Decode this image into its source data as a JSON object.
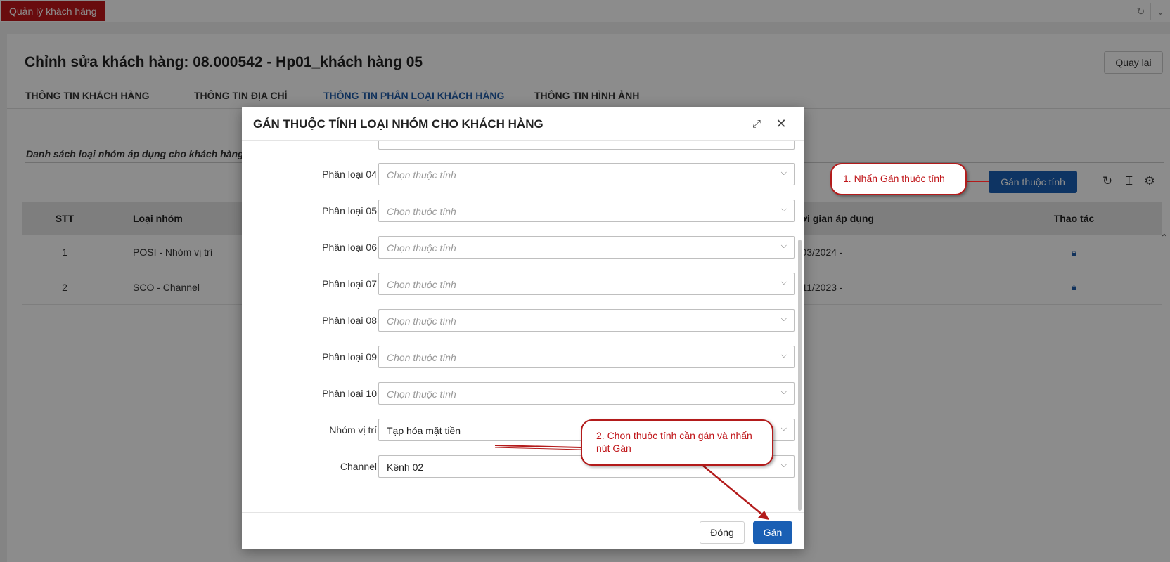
{
  "app_tab": "Quản lý khách hàng",
  "page": {
    "title": "Chỉnh sửa khách hàng: 08.000542 - Hp01_khách hàng 05",
    "back_label": "Quay lại",
    "tabs": [
      {
        "label": "THÔNG TIN KHÁCH HÀNG"
      },
      {
        "label": "THÔNG TIN ĐỊA CHỈ"
      },
      {
        "label": "THÔNG TIN PHÂN LOẠI KHÁCH HÀNG"
      },
      {
        "label": "THÔNG TIN HÌNH ẢNH"
      }
    ],
    "list_title": "Danh sách loại nhóm áp dụng cho khách hàng",
    "assign_label": "Gán thuộc tính",
    "table": {
      "headers": {
        "stt": "STT",
        "group": "Loại nhóm",
        "time": "Thời gian áp dụng",
        "action": "Thao tác"
      },
      "rows": [
        {
          "stt": "1",
          "group": "POSI - Nhóm vị trí",
          "time": "11/03/2024 -"
        },
        {
          "stt": "2",
          "group": "SCO - Channel",
          "time": "22/11/2023 -"
        }
      ]
    }
  },
  "modal": {
    "title": "GÁN THUỘC TÍNH LOẠI NHÓM CHO KHÁCH HÀNG",
    "placeholder": "Chọn thuộc tính",
    "fields": [
      {
        "label": "Phân loại 04",
        "value": ""
      },
      {
        "label": "Phân loại 05",
        "value": ""
      },
      {
        "label": "Phân loại 06",
        "value": ""
      },
      {
        "label": "Phân loại 07",
        "value": ""
      },
      {
        "label": "Phân loại 08",
        "value": ""
      },
      {
        "label": "Phân loại 09",
        "value": ""
      },
      {
        "label": "Phân loại 10",
        "value": ""
      },
      {
        "label": "Nhóm vị trí",
        "value": "Tạp hóa mặt tiền"
      },
      {
        "label": "Channel",
        "value": "Kênh 02"
      }
    ],
    "close_label": "Đóng",
    "submit_label": "Gán"
  },
  "callouts": {
    "step1": "1. Nhấn Gán thuộc tính",
    "step2": "2. Chọn thuộc tính cần gán và nhấn nút Gán"
  },
  "icons": {
    "refresh": "refresh-icon",
    "column": "column-icon",
    "settings": "gear-icon",
    "lock": "lock-icon",
    "expand": "expand-icon",
    "close": "close-icon",
    "chevron": "chevron-down-icon"
  },
  "colors": {
    "brand_red": "#c0161a",
    "primary_blue": "#1a5fb4",
    "link_blue": "#1f5ba8"
  }
}
